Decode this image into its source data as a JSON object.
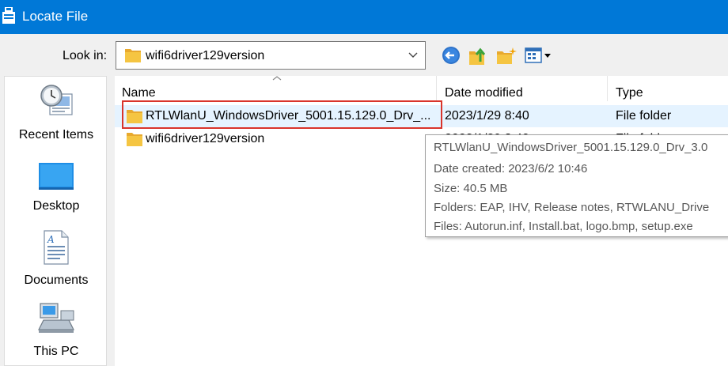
{
  "window": {
    "title": "Locate File"
  },
  "look_in": {
    "label": "Look in:",
    "value": "wifi6driver129version"
  },
  "toolbar": {
    "back_icon": "back-arrow-icon",
    "up_icon": "up-one-level-icon",
    "new_folder_icon": "new-folder-icon",
    "view_icon": "view-menu-icon"
  },
  "places": [
    {
      "label": "Recent Items",
      "icon": "recent-items-icon"
    },
    {
      "label": "Desktop",
      "icon": "desktop-icon"
    },
    {
      "label": "Documents",
      "icon": "documents-icon"
    },
    {
      "label": "This PC",
      "icon": "this-pc-icon"
    }
  ],
  "columns": [
    "Name",
    "Date modified",
    "Type"
  ],
  "files": [
    {
      "name": "RTLWlanU_WindowsDriver_5001.15.129.0_Drv_...",
      "date": "2023/1/29 8:40",
      "type": "File folder",
      "selected": true
    },
    {
      "name": "wifi6driver129version",
      "date": "2023/1/29 8:40",
      "type": "File folder",
      "selected": false
    }
  ],
  "tooltip": {
    "lines": [
      "RTLWlanU_WindowsDriver_5001.15.129.0_Drv_3.0",
      "Date created: 2023/6/2 10:46",
      "Size: 40.5 MB",
      "Folders: EAP, IHV, Release notes, RTWLANU_Drive",
      "Files: Autorun.inf, Install.bat, logo.bmp, setup.exe"
    ]
  },
  "colors": {
    "titlebar": "#0078d7",
    "selection": "#e5f3ff",
    "highlight": "#d9342b",
    "folder": "#f5c542"
  }
}
